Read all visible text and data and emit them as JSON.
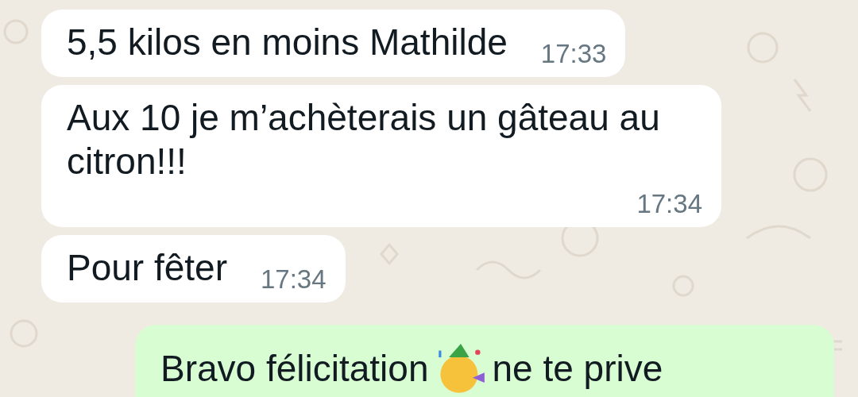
{
  "messages": [
    {
      "kind": "incoming",
      "text": "5,5 kilos en moins Mathilde",
      "time": "17:33"
    },
    {
      "kind": "incoming",
      "text": "Aux 10 je m’achèterais un gâteau au citron!!!",
      "time": "17:34"
    },
    {
      "kind": "incoming",
      "text": "Pour fêter",
      "time": "17:34"
    },
    {
      "kind": "outgoing",
      "text": "Bravo félicitation",
      "emoji": true,
      "text_after": "ne te prive"
    }
  ]
}
